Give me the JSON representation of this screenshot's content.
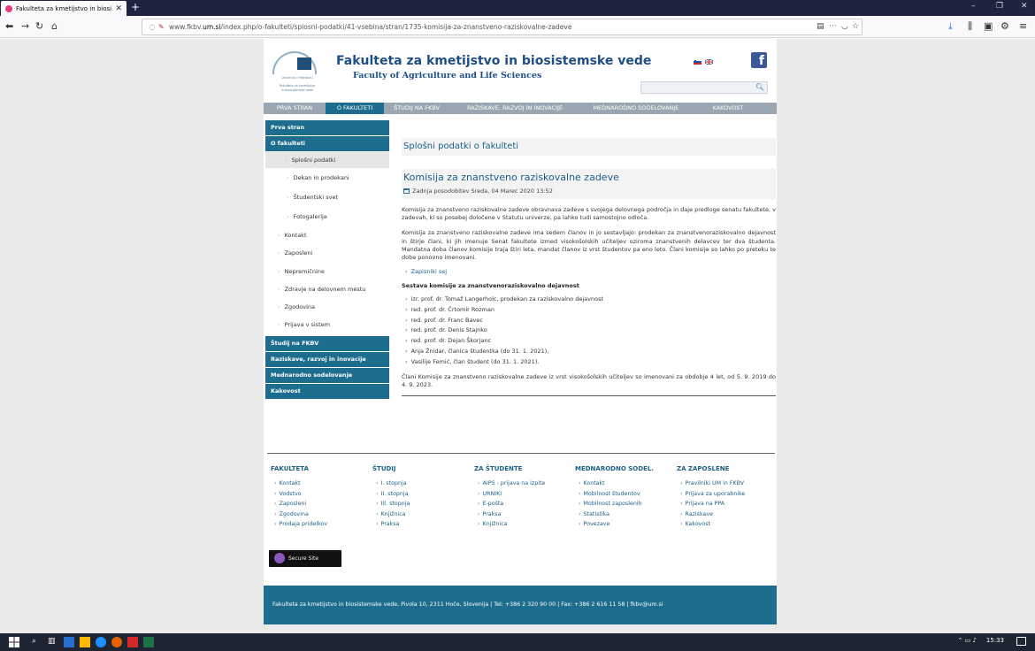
{
  "browser": {
    "tab_title": "Fakulteta za kmetijstvo in biosi",
    "url_prefix": "www.fkbv.",
    "url_domain": "um.si",
    "url_rest": "/index.php/o-fakulteti/splosni-podatki/41-vsebina/stran/1735-komisija-za-znanstveno-raziskovalne-zadeve"
  },
  "header": {
    "title": "Fakulteta za kmetijstvo in biosistemske vede",
    "subtitle": "Faculty of Agriculture and Life Sciences",
    "logo_text_1": "Univerza v Mariboru",
    "logo_text_2": "Fakulteta za kmetijstvo",
    "logo_text_3": "in biosistemske vede",
    "fb_letter": "f"
  },
  "mainnav": [
    "PRVA STRAN",
    "O FAKULTETI",
    "ŠTUDIJ NA FKBV",
    "RAZISKAVE, RAZVOJ IN INOVACIJE",
    "MEDNARODNO SODELOVANJE",
    "KAKOVOST"
  ],
  "sidebar": {
    "prva_stran": "Prva stran",
    "o_fakulteti": "O fakulteti",
    "splosni": "Splošni podatki",
    "dekan": "Dekan in prodekani",
    "studentski_svet": "Študentski svet",
    "fotogalerija": "Fotogalerije",
    "kontakt": "Kontakt",
    "zaposleni": "Zaposleni",
    "nepremicnine": "Nepremičnine",
    "zdravje": "Zdravje na delovnem mestu",
    "zgodovina": "Zgodovina",
    "prijava": "Prijava v sistem",
    "studij": "Študij na FKBV",
    "raziskave": "Raziskave, razvoj in inovacije",
    "mednarodno": "Mednarodno sodelovanje",
    "kakovost": "Kakovost"
  },
  "content": {
    "section_title": "Splošni podatki o fakulteti",
    "article_title": "Komisija za znanstveno raziskovalne zadeve",
    "date": "Zadnja posodobitev Sreda, 04 Marec 2020 13:52",
    "p1": "Komisija za znanstveno raziskovalne zadeve obravnava zadeve s svojega delovnega področja in daje predloge senatu fakultete, v zadevah, ki so posebej določene v Statutu univerze, pa lahko tudi samostojno odloča.",
    "p2": "Komisija za znanstveno raziskovalne zadeve ima sedem članov in jo sestavljajo: prodekan za znanstvenoraziskovalno dejavnost in štirje člani, ki jih imenuje Senat fakultete izmed visokošolskih učiteljev oziroma znanstvenih delavcev ter dva študenta. Mandatna doba članov komisije traja štiri leta, mandat članov iz vrst študentov pa eno leto. Člani komisije so lahko po preteku te dobe ponovno imenovani.",
    "zapisniki": "Zapisniki sej",
    "sestava": "Sestava komisije za znanstvenoraziskovalno dejavnost",
    "members": [
      "izr. prof. dr. Tomaž Langerholc, prodekan za raziskovalno dejavnost",
      "red. prof. dr. Črtomir Rozman",
      "red. prof. dr. Franc Bavec",
      "red. prof. dr. Denis Stajnko",
      "red. prof. dr. Dejan Škorjanc",
      "Anja Žnidar, članica študentka (do 31. 1. 2021),",
      "Vasilije Femić, član študent (do 31. 1. 2021)."
    ],
    "p3": "Člani Komisije za znanstveno raziskovalne zadeve iz vrst visokošolskih učiteljev so imenovani za obdobje 4 let, od 5. 9. 2019 do 4. 9. 2023."
  },
  "footer": {
    "cols": [
      {
        "head": "FAKULTETA",
        "links": [
          "Kontakt",
          "Vodstvo",
          "Zaposleni",
          "Zgodovina",
          "Prodaja pridelkov"
        ]
      },
      {
        "head": "ŠTUDIJ",
        "links": [
          "I. stopnja",
          "II. stopnja",
          "III. stopnja",
          "Knjižnica",
          "Praksa"
        ]
      },
      {
        "head": "ZA ŠTUDENTE",
        "links": [
          "AIPS - prijava na izpite",
          "URNIKI",
          "E-pošta",
          "Praksa",
          "Knjižnica"
        ]
      },
      {
        "head": "MEDNARODNO SODEL.",
        "links": [
          "Kontakt",
          "Mobilnost študentov",
          "Mobilnost zaposlenih",
          "Statistika",
          "Povezave"
        ]
      },
      {
        "head": "ZA ZAPOSLENE",
        "links": [
          "Pravilniki UM in FKBV",
          "Prijava za uporabnike",
          "Prijava na PPA",
          "Raziskave",
          "Kakovost"
        ]
      }
    ],
    "secure": "Secure Site",
    "bottom": "Fakulteta za kmetijstvo in biosistemske vede, Pivola 10, 2311 Hoče, Slovenija | Tel: +386 2 320 90 00 | Fax: +386 2 616 11 58 | fkbv@um.si"
  },
  "taskbar": {
    "time": "15:33"
  },
  "colors": {
    "accent": "#1d6e8e",
    "link": "#1b5f86",
    "nav_gray": "#9aa7b2"
  }
}
